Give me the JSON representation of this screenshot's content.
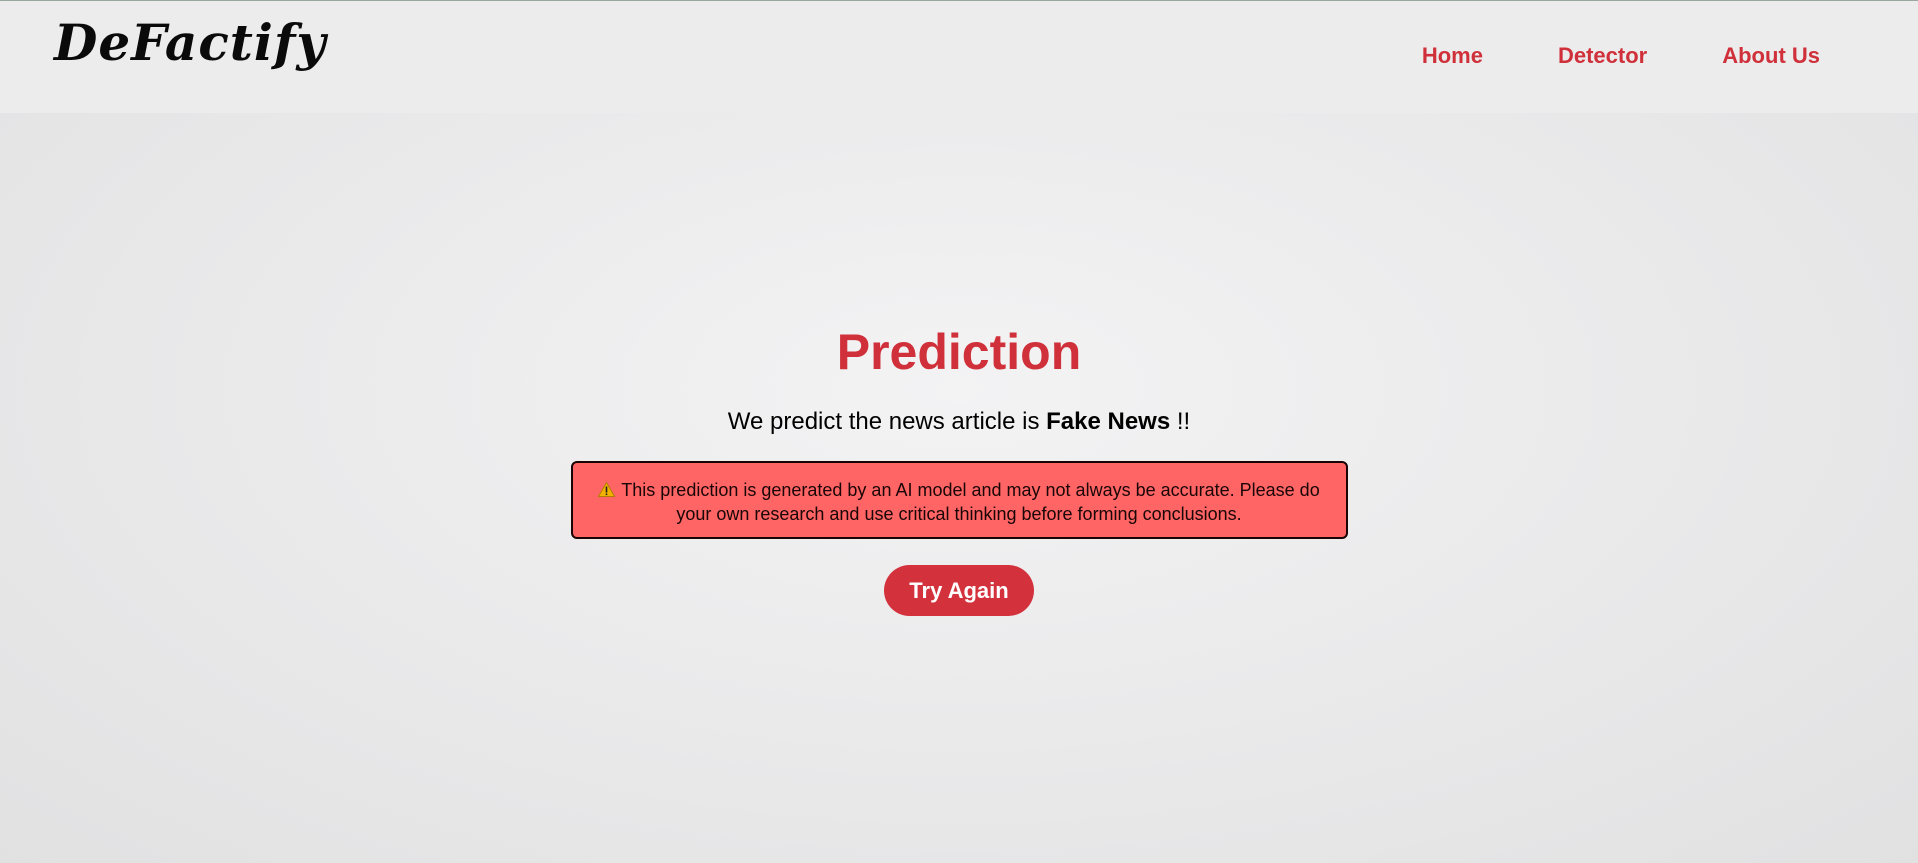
{
  "brand": {
    "logo_text": "DeFactify"
  },
  "nav": {
    "items": [
      {
        "label": "Home"
      },
      {
        "label": "Detector"
      },
      {
        "label": "About Us"
      }
    ]
  },
  "prediction": {
    "title": "Prediction",
    "sentence_prefix": "We predict the news article is ",
    "label": "Fake News",
    "sentence_suffix": " !!",
    "warning_icon": "warning-triangle-icon",
    "disclaimer": "This prediction is generated by an AI model and may not always be accurate. Please do your own research and use critical thinking before forming conclusions.",
    "button_label": "Try Again"
  },
  "colors": {
    "accent": "#d0303a",
    "alert_bg": "#ff6565",
    "header_bg": "#ececec"
  }
}
